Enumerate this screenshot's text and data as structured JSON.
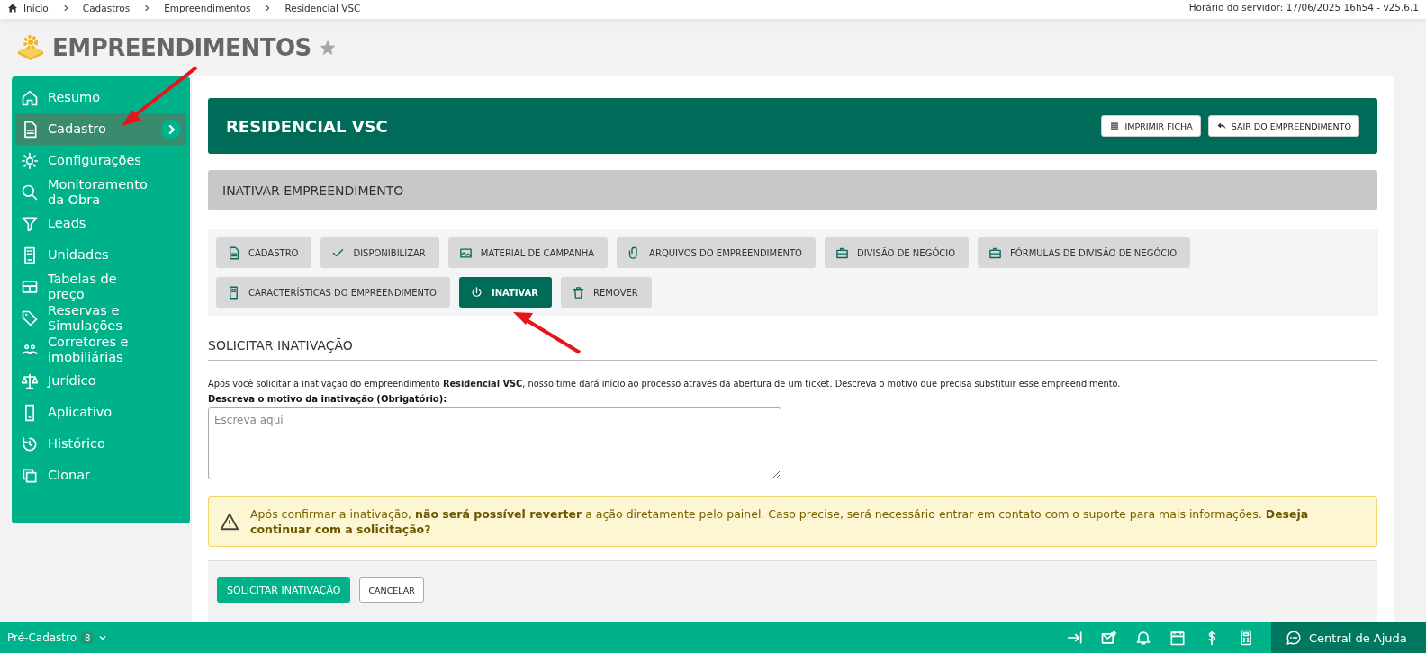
{
  "breadcrumb": [
    "Início",
    "Cadastros",
    "Empreendimentos",
    "Residencial VSC"
  ],
  "server_info": "Horário do servidor: 17/06/2025 16h54 - v25.6.1",
  "page_title": "EMPREENDIMENTOS",
  "favorite": false,
  "sidebar": {
    "items": [
      {
        "label": "Resumo",
        "selected": false
      },
      {
        "label": "Cadastro",
        "selected": true
      },
      {
        "label": "Configurações",
        "selected": false
      },
      {
        "label": "Monitoramento da Obra",
        "selected": false
      },
      {
        "label": "Leads",
        "selected": false
      },
      {
        "label": "Unidades",
        "selected": false
      },
      {
        "label": "Tabelas de preço",
        "selected": false
      },
      {
        "label": "Reservas e Simulações",
        "selected": false
      },
      {
        "label": "Corretores e imobiliárias",
        "selected": false
      },
      {
        "label": "Jurídico",
        "selected": false
      },
      {
        "label": "Aplicativo",
        "selected": false
      },
      {
        "label": "Histórico",
        "selected": false
      },
      {
        "label": "Clonar",
        "selected": false
      }
    ]
  },
  "project": {
    "name": "RESIDENCIAL VSC",
    "actions": [
      "IMPRIMIR FICHA",
      "SAIR DO EMPREENDIMENTO"
    ]
  },
  "section_bar": "INATIVAR EMPREENDIMENTO",
  "tabs": [
    {
      "label": "CADASTRO",
      "selected": false
    },
    {
      "label": "DISPONIBILIZAR",
      "selected": false
    },
    {
      "label": "MATERIAL DE CAMPANHA",
      "selected": false
    },
    {
      "label": "ARQUIVOS DO EMPREENDIMENTO",
      "selected": false
    },
    {
      "label": "DIVISÃO DE NEGÓCIO",
      "selected": false
    },
    {
      "label": "FÓRMULAS DE DIVISÃO DE NEGÓCIO",
      "selected": false
    },
    {
      "label": "CARACTERÍSTICAS DO EMPREENDIMENTO",
      "selected": false
    },
    {
      "label": "INATIVAR",
      "selected": true
    },
    {
      "label": "REMOVER",
      "selected": false
    }
  ],
  "form": {
    "title": "SOLICITAR INATIVAÇÃO",
    "intro": "Após você solicitar a inativação do empreendimento **Residencial VSC**, nosso time dará início ao processo através da abertura de um ticket. Descreva o motivo que precisa substituir esse empreendimento.",
    "field_label": "Descreva o motivo da inativação (Obrigatório):",
    "placeholder": "Escreva aqui",
    "warning": "Após confirmar a inativação, **não será possível reverter** a ação diretamente pelo painel. Caso precise, será necessário entrar em contato com o suporte para mais informações. **Deseja continuar com a solicitação?**",
    "submit": "SOLICITAR INATIVAÇÃO",
    "cancel": "CANCELAR"
  },
  "footer": {
    "pre_cadastro": "Pré-Cadastro",
    "count": "8",
    "help": "Central de Ajuda"
  }
}
